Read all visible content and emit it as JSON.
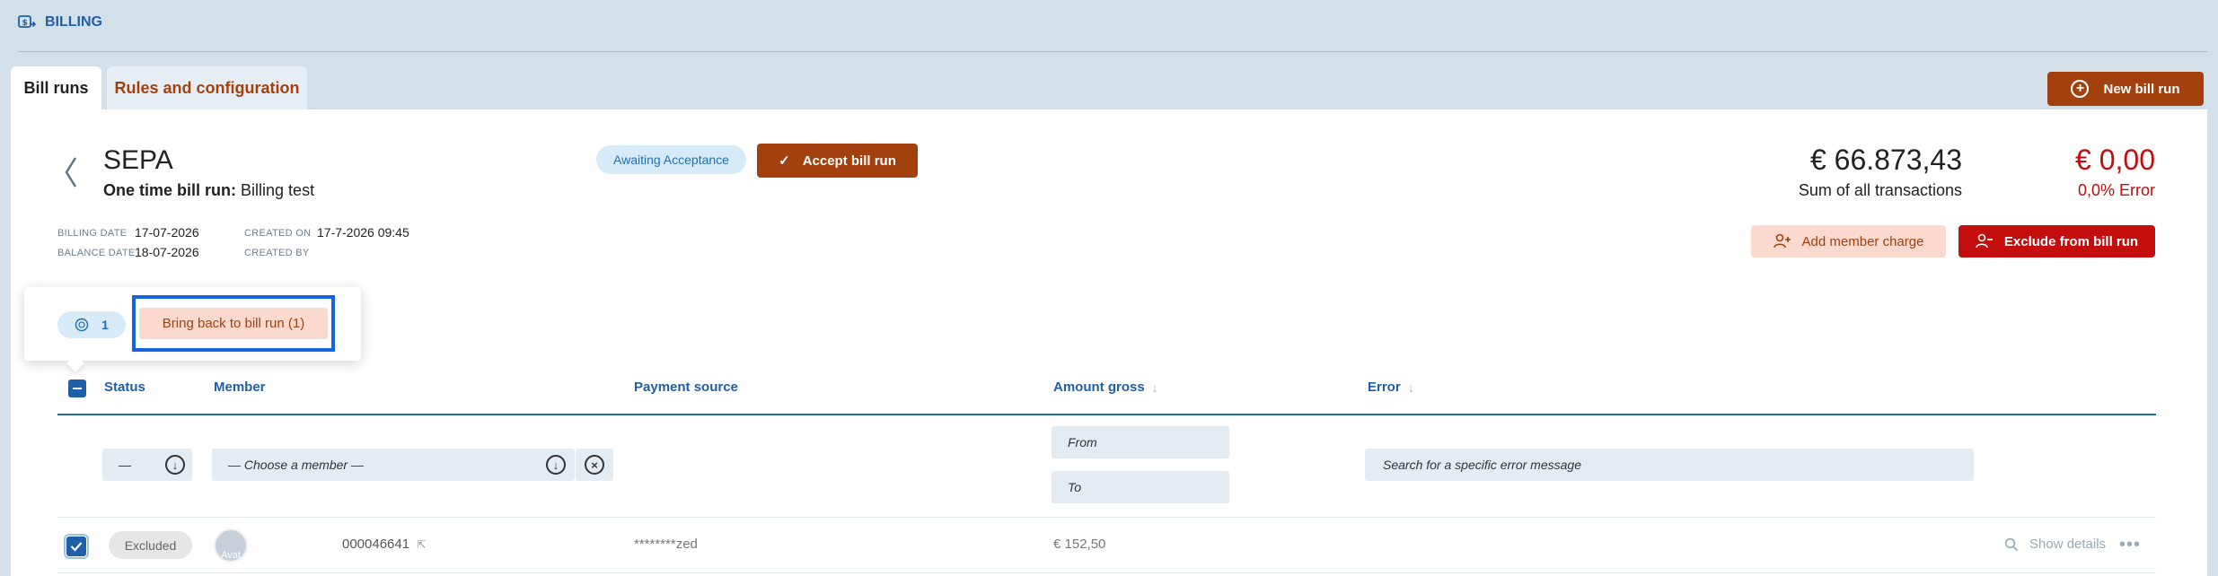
{
  "header": {
    "app_title": "BILLING",
    "icon": "billing-icon"
  },
  "tabs": [
    {
      "label": "Bill runs",
      "active": true
    },
    {
      "label": "Rules and configuration",
      "active": false
    }
  ],
  "actions": {
    "new_bill_run": "New bill run"
  },
  "bill_run": {
    "name": "SEPA",
    "type_label": "One time bill run:",
    "type_value": "Billing test",
    "status_badge": "Awaiting Acceptance",
    "accept_label": "Accept bill run",
    "billing_date_label": "BILLING DATE",
    "billing_date": "17-07-2026",
    "balance_date_label": "BALANCE DATE",
    "balance_date": "18-07-2026",
    "created_on_label": "CREATED ON",
    "created_on": "17-7-2026 09:45",
    "created_by_label": "CREATED BY",
    "created_by": ""
  },
  "totals": {
    "sum_amount": "€ 66.873,43",
    "sum_label": "Sum of all transactions",
    "error_amount": "€ 0,00",
    "error_label": "0,0% Error"
  },
  "member_actions": {
    "add_charge": "Add member charge",
    "exclude": "Exclude from bill run"
  },
  "selection": {
    "count": "1",
    "bring_back": "Bring back to bill run (1)"
  },
  "table": {
    "columns": [
      "Status",
      "Member",
      "Payment source",
      "Amount gross",
      "Error"
    ],
    "filters": {
      "status_value": "—",
      "member_placeholder": "— Choose a member —",
      "amount_from": "From",
      "amount_to": "To",
      "error_placeholder": "Search for a specific error message"
    },
    "rows": [
      {
        "status": "Excluded",
        "avatar_alt": "Avat",
        "member_id": "000046641",
        "payment_source": "********zed",
        "amount": "€ 152,50",
        "details_label": "Show details"
      }
    ]
  },
  "colors": {
    "brand_blue": "#1f5fa8",
    "accent_brown": "#a2410d",
    "danger_red": "#c40d0d",
    "page_bg": "#d3e0ea"
  }
}
